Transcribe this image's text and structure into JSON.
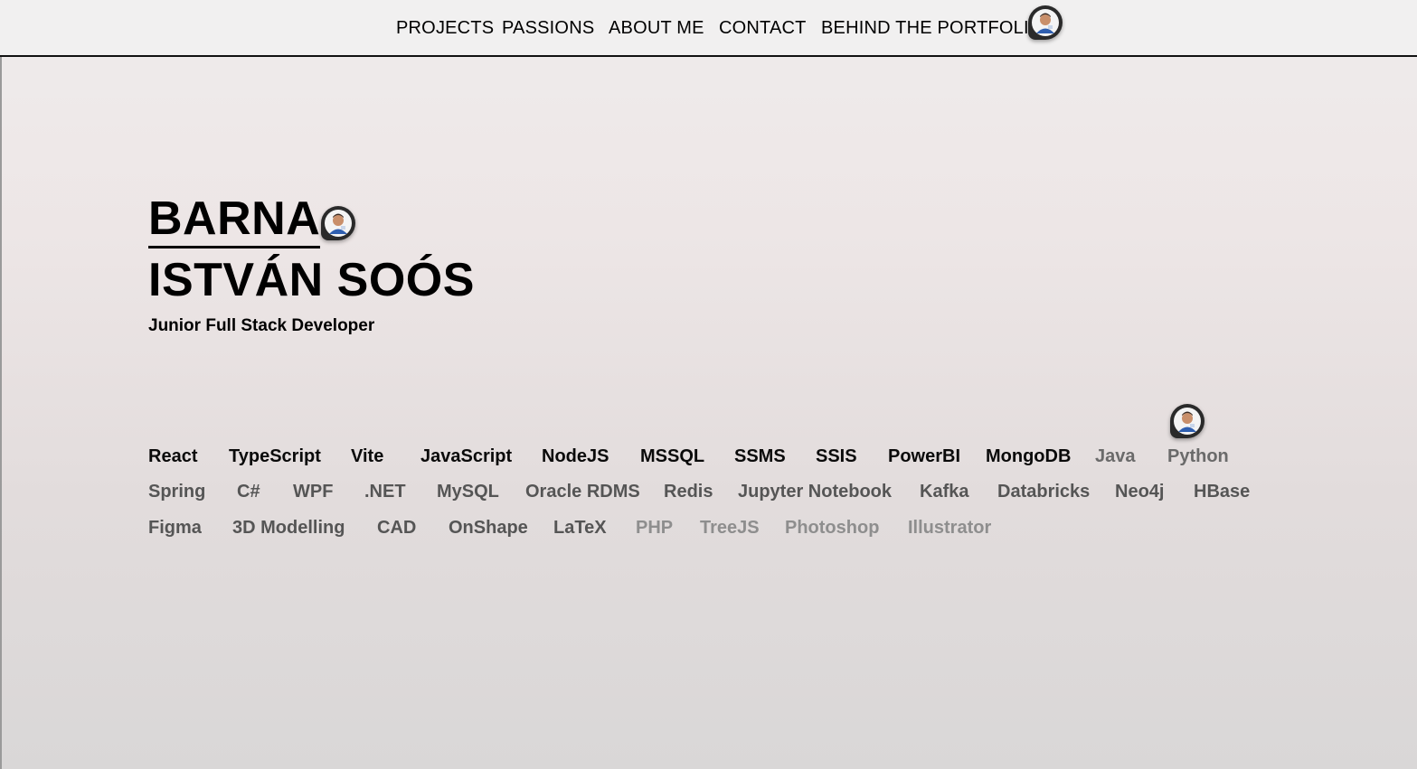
{
  "nav": {
    "items": [
      {
        "label": "PROJECTS"
      },
      {
        "label": "PASSIONS"
      },
      {
        "label": "ABOUT ME"
      },
      {
        "label": "CONTACT"
      },
      {
        "label": "BEHIND THE PORTFOLIO"
      }
    ]
  },
  "hero": {
    "first_name": "BARNA",
    "last_name": "ISTVÁN SOÓS",
    "role": "Junior Full Stack Developer"
  },
  "skills": [
    {
      "label": "React"
    },
    {
      "label": "TypeScript"
    },
    {
      "label": "Vite"
    },
    {
      "label": "JavaScript"
    },
    {
      "label": "NodeJS"
    },
    {
      "label": "MSSQL"
    },
    {
      "label": "SSMS"
    },
    {
      "label": "SSIS"
    },
    {
      "label": "PowerBI"
    },
    {
      "label": "MongoDB"
    },
    {
      "label": "Java"
    },
    {
      "label": "Python"
    },
    {
      "label": "Spring"
    },
    {
      "label": "C#"
    },
    {
      "label": "WPF"
    },
    {
      "label": ".NET"
    },
    {
      "label": "MySQL"
    },
    {
      "label": "Oracle RDMS"
    },
    {
      "label": "Redis"
    },
    {
      "label": "Jupyter Notebook"
    },
    {
      "label": "Kafka"
    },
    {
      "label": "Databricks"
    },
    {
      "label": "Neo4j"
    },
    {
      "label": "HBase"
    },
    {
      "label": "Figma"
    },
    {
      "label": "3D Modelling"
    },
    {
      "label": "CAD"
    },
    {
      "label": "OnShape"
    },
    {
      "label": "LaTeX"
    },
    {
      "label": "PHP"
    },
    {
      "label": "TreeJS"
    },
    {
      "label": "Photoshop"
    },
    {
      "label": "Illustrator"
    }
  ],
  "icons": {
    "avatar": "memoji-avatar-icon"
  },
  "colors": {
    "background": "#ede6e6",
    "nav_background": "#f1f0f0",
    "text_primary": "#000000"
  }
}
